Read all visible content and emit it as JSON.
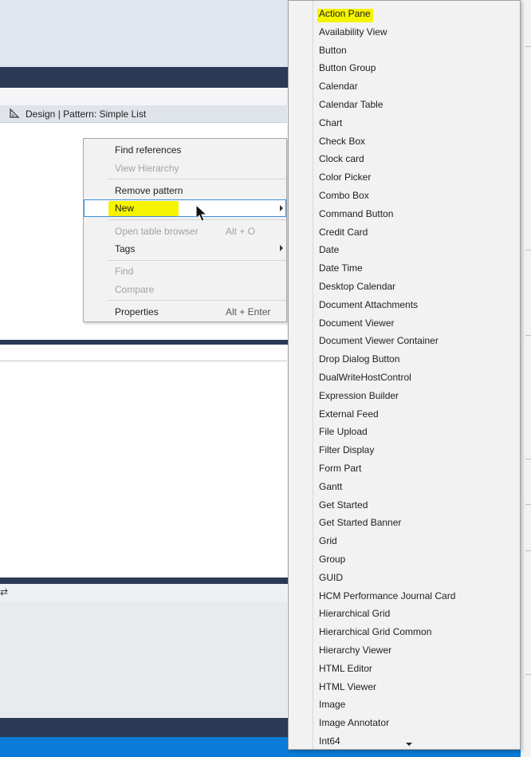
{
  "designer": {
    "title": "Design | Pattern: Simple List"
  },
  "context_menu": {
    "items": [
      {
        "label": "Find references",
        "shortcut": "",
        "disabled": false
      },
      {
        "label": "View Hierarchy",
        "shortcut": "",
        "disabled": true
      },
      {
        "label": "Remove pattern",
        "shortcut": "",
        "disabled": false
      },
      {
        "label": "New",
        "shortcut": "",
        "disabled": false,
        "submenu": true,
        "highlighted": true
      },
      {
        "label": "Open table browser",
        "shortcut": "Alt + O",
        "disabled": true
      },
      {
        "label": "Tags",
        "shortcut": "",
        "disabled": false,
        "submenu": true
      },
      {
        "label": "Find",
        "shortcut": "",
        "disabled": true
      },
      {
        "label": "Compare",
        "shortcut": "",
        "disabled": true
      },
      {
        "label": "Properties",
        "shortcut": "Alt + Enter",
        "disabled": false
      }
    ]
  },
  "submenu": {
    "items": [
      "Action Pane",
      "Availability View",
      "Button",
      "Button Group",
      "Calendar",
      "Calendar Table",
      "Chart",
      "Check Box",
      "Clock card",
      "Color Picker",
      "Combo Box",
      "Command Button",
      "Credit Card",
      "Date",
      "Date Time",
      "Desktop Calendar",
      "Document Attachments",
      "Document Viewer",
      "Document Viewer Container",
      "Drop Dialog Button",
      "DualWriteHostControl",
      "Expression Builder",
      "External Feed",
      "File Upload",
      "Filter Display",
      "Form Part",
      "Gantt",
      "Get Started",
      "Get Started Banner",
      "Grid",
      "Group",
      "GUID",
      "HCM Performance Journal Card",
      "Hierarchical Grid",
      "Hierarchical Grid Common",
      "Hierarchy Viewer",
      "HTML Editor",
      "HTML Viewer",
      "Image",
      "Image Annotator",
      "Int64"
    ],
    "highlighted": "Action Pane"
  },
  "colors": {
    "highlight": "#f5f300",
    "menu_bg": "#f2f2f2",
    "hover_border": "#3c8dde",
    "dark_band": "#2b3a55",
    "status_blue": "#0a7bd6"
  },
  "icons": {
    "designer": "design-pattern-icon",
    "cursor": "mouse-pointer-icon",
    "submenu_arrow": "chevron-right-icon",
    "scroll": "scroll-down-arrow-icon"
  }
}
